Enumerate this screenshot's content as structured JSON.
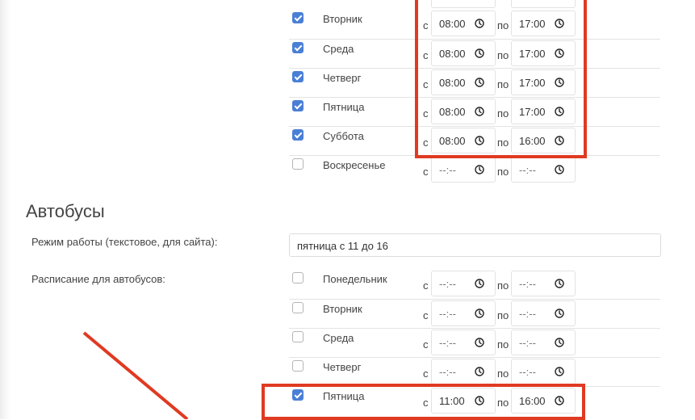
{
  "upper_schedule": {
    "from_label": "с",
    "to_label": "по",
    "rows": [
      {
        "day": "Вторник",
        "checked": true,
        "from": "08:00",
        "to": "17:00"
      },
      {
        "day": "Среда",
        "checked": true,
        "from": "08:00",
        "to": "17:00"
      },
      {
        "day": "Четверг",
        "checked": true,
        "from": "08:00",
        "to": "17:00"
      },
      {
        "day": "Пятница",
        "checked": true,
        "from": "08:00",
        "to": "17:00"
      },
      {
        "day": "Суббота",
        "checked": true,
        "from": "08:00",
        "to": "16:00"
      },
      {
        "day": "Воскресенье",
        "checked": false,
        "from": "--:--",
        "to": "--:--"
      }
    ]
  },
  "buses": {
    "title": "Автобусы",
    "mode_label": "Режим работы (текстовое, для сайта):",
    "mode_value": "пятница с 11 до 16",
    "schedule_label": "Расписание для автобусов:",
    "rows": [
      {
        "day": "Понедельник",
        "checked": false,
        "from": "--:--",
        "to": "--:--"
      },
      {
        "day": "Вторник",
        "checked": false,
        "from": "--:--",
        "to": "--:--"
      },
      {
        "day": "Среда",
        "checked": false,
        "from": "--:--",
        "to": "--:--"
      },
      {
        "day": "Четверг",
        "checked": false,
        "from": "--:--",
        "to": "--:--"
      },
      {
        "day": "Пятница",
        "checked": true,
        "from": "11:00",
        "to": "16:00"
      }
    ]
  },
  "colors": {
    "accent": "#4a7fd5",
    "annotation": "#e03a22"
  },
  "icons": {
    "time_picker": "clock-icon"
  }
}
